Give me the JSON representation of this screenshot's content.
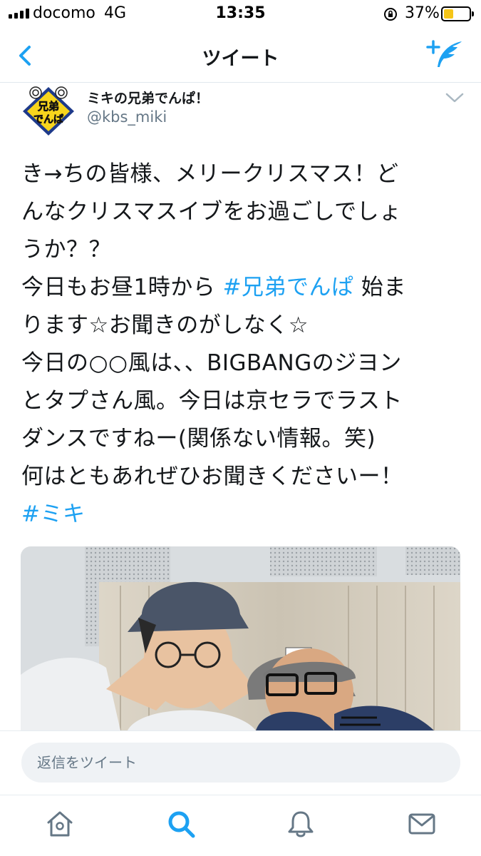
{
  "status_bar": {
    "carrier": "docomo",
    "network": "4G",
    "time": "13:35",
    "battery_percent": "37%",
    "battery_level": 0.37,
    "icons": [
      "signal-icon",
      "rotation-lock-icon",
      "battery-icon"
    ]
  },
  "nav": {
    "title": "ツイート",
    "back_icon": "chevron-left-icon",
    "compose_icon": "compose-tweet-icon"
  },
  "tweet": {
    "display_name": "ミキの兄弟でんぱ！",
    "handle": "@kbs_miki",
    "avatar_logo_text": "兄弟でんぱ",
    "lines": [
      {
        "parts": [
          {
            "text": "き→ちの皆様、メリークリスマス！ど",
            "tag": false
          }
        ]
      },
      {
        "parts": [
          {
            "text": "んなクリスマスイブをお過ごしでしょ",
            "tag": false
          }
        ]
      },
      {
        "parts": [
          {
            "text": "うか？？",
            "tag": false
          }
        ]
      },
      {
        "parts": [
          {
            "text": "今日もお昼1時から ",
            "tag": false
          },
          {
            "text": "#兄弟でんぱ",
            "tag": true
          },
          {
            "text": " 始ま",
            "tag": false
          }
        ]
      },
      {
        "parts": [
          {
            "text": "ります☆お聞きのがしなく☆",
            "tag": false
          }
        ]
      },
      {
        "parts": [
          {
            "text": "今日の○○風は、、BIGBANGのジヨン",
            "tag": false
          }
        ]
      },
      {
        "parts": [
          {
            "text": "とタプさん風。今日は京セラでラスト",
            "tag": false
          }
        ]
      },
      {
        "parts": [
          {
            "text": "ダンスですねー(関係ない情報。笑)",
            "tag": false
          }
        ]
      },
      {
        "parts": [
          {
            "text": "何はともあれぜひお聞きくださいー！",
            "tag": false
          }
        ]
      },
      {
        "parts": [
          {
            "text": "#ミキ",
            "tag": true
          }
        ]
      }
    ]
  },
  "reply": {
    "placeholder": "返信をツイート"
  },
  "tabbar": {
    "tabs": [
      {
        "icon": "home-icon",
        "active": false
      },
      {
        "icon": "search-icon",
        "active": true
      },
      {
        "icon": "notifications-bell-icon",
        "active": false
      },
      {
        "icon": "messages-envelope-icon",
        "active": false
      }
    ]
  },
  "colors": {
    "accent": "#1da1f2",
    "text": "#14171a",
    "secondary_text": "#657786",
    "inactive_icon": "#657786"
  }
}
